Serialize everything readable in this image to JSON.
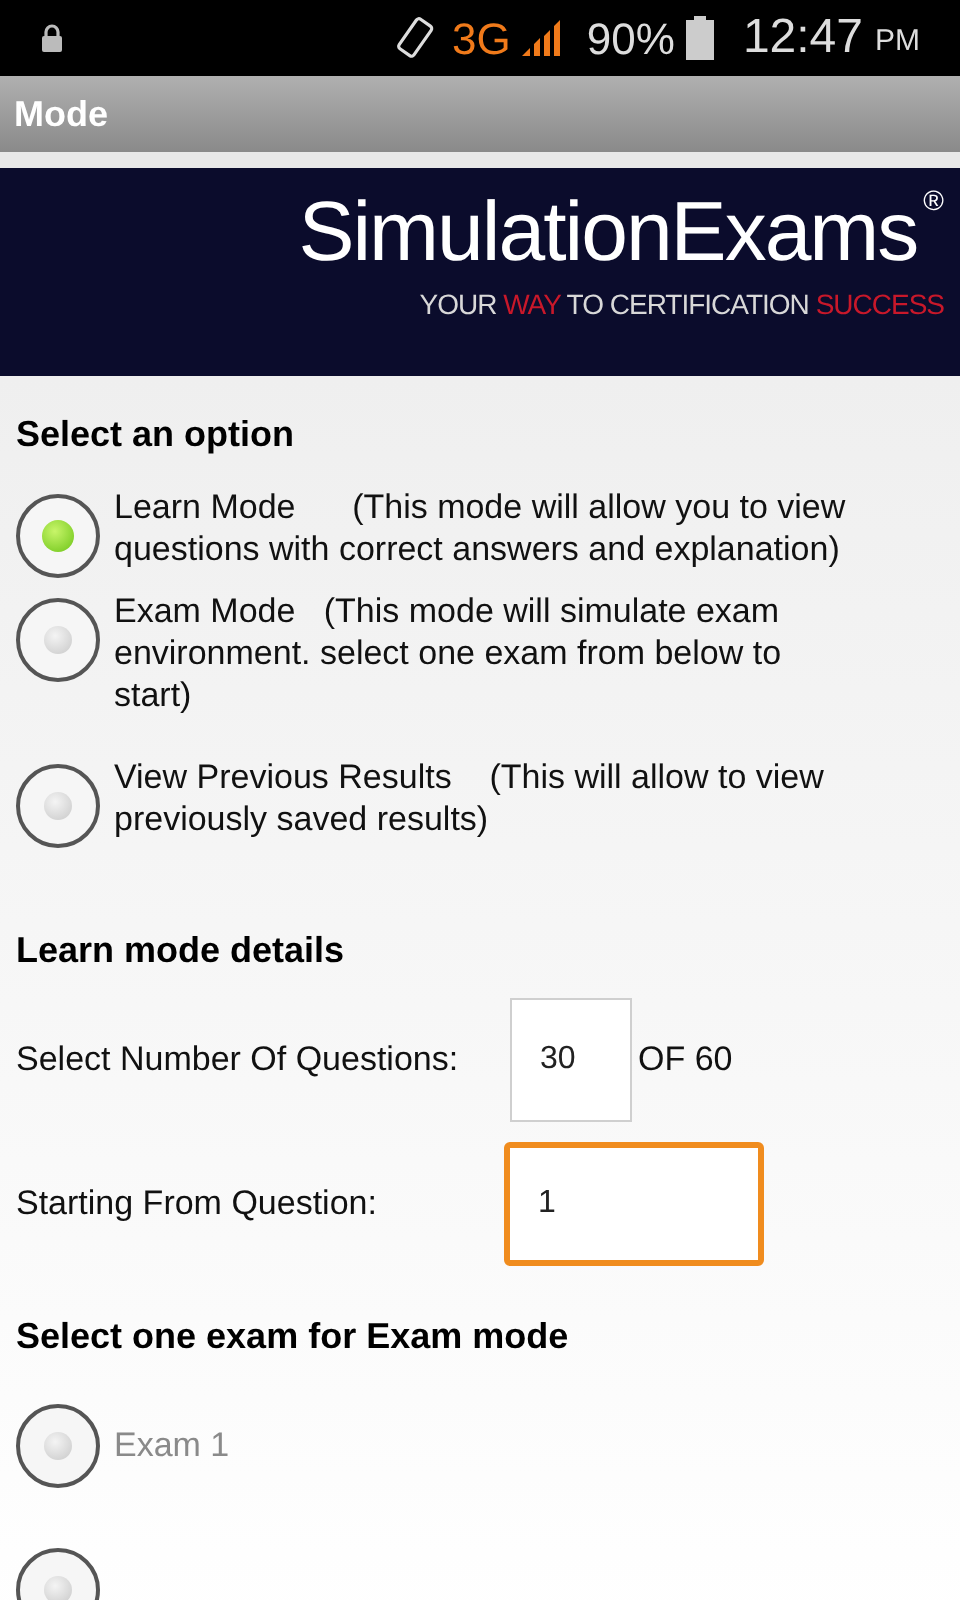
{
  "status_bar": {
    "network": "3G",
    "battery": "90%",
    "time": "12:47",
    "ampm": "PM"
  },
  "title_bar": {
    "title": "Mode"
  },
  "banner": {
    "logo": "SimulationExams",
    "mark": "®",
    "tagline": [
      {
        "text": "YOUR ",
        "accent": false
      },
      {
        "text": "WAY",
        "accent": true
      },
      {
        "text": " TO CERTIFICATION ",
        "accent": false
      },
      {
        "text": "SUCCESS",
        "accent": true
      }
    ]
  },
  "options_heading": "Select an option",
  "options": [
    {
      "label": "Learn Mode      (This mode will allow you to view questions with correct answers and explanation)",
      "selected": true
    },
    {
      "label": "Exam Mode   (This mode will simulate exam environment. select one exam from below to start)",
      "selected": false
    },
    {
      "label": "View Previous Results    (This will allow to view previously saved results)",
      "selected": false
    }
  ],
  "details_heading": "Learn mode details",
  "questions": {
    "label": "Select Number Of Questions:",
    "value": "30",
    "suffix": "OF 60",
    "focused": false
  },
  "start": {
    "label": "Starting From Question:",
    "value": "1",
    "focused": true
  },
  "exams_heading": "Select one exam for Exam mode",
  "exams": [
    {
      "label": "Exam 1",
      "selected": false,
      "disabled": true
    },
    {
      "selected": false
    }
  ]
}
